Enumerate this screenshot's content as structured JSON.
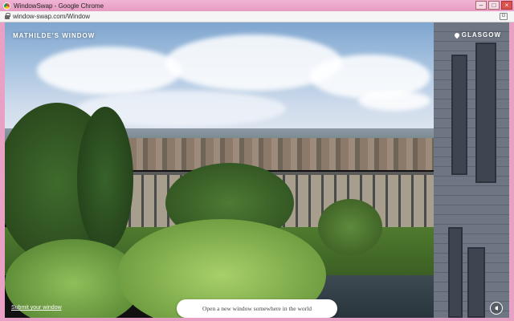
{
  "window": {
    "title": "WindowSwap - Google Chrome",
    "controls": {
      "minimize": "–",
      "maximize": "□",
      "close": "×"
    }
  },
  "browser": {
    "url": "window-swap.com/Window",
    "translate_label": "G"
  },
  "page": {
    "room_label": "MATHILDE'S WINDOW",
    "city_label": "GLASGOW",
    "submit_link": "Submit your window",
    "new_window_button": "Open a new window somewhere in the world"
  },
  "icons": {
    "app": "chrome-icon",
    "lock": "lock-icon",
    "pin": "location-pin-icon",
    "sound": "speaker-icon"
  }
}
